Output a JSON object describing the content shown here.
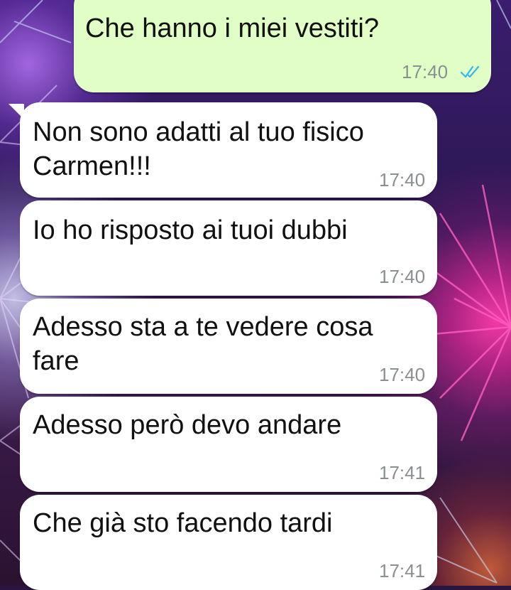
{
  "chat": {
    "messages": [
      {
        "direction": "outgoing",
        "text": "Che hanno i miei vestiti?",
        "time": "17:40",
        "status": "read"
      },
      {
        "direction": "incoming",
        "text": "Non sono adatti al tuo fisico Carmen!!!",
        "time": "17:40"
      },
      {
        "direction": "incoming",
        "text": "Io ho risposto ai tuoi dubbi",
        "time": "17:40"
      },
      {
        "direction": "incoming",
        "text": "Adesso sta a te vedere cosa fare",
        "time": "17:40"
      },
      {
        "direction": "incoming",
        "text": "Adesso però devo andare",
        "time": "17:41"
      },
      {
        "direction": "incoming",
        "text": "Che già sto facendo tardi",
        "time": "17:41"
      }
    ]
  },
  "colors": {
    "outgoing_bubble": "#e1fec6",
    "incoming_bubble": "#ffffff",
    "read_ticks": "#34b7f1",
    "timestamp": "#8a8f92"
  },
  "icons": {
    "read_receipt": "double-check-icon"
  }
}
